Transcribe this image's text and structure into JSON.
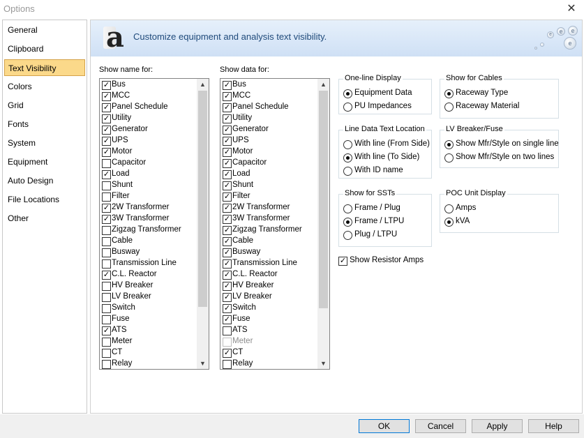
{
  "window": {
    "title": "Options",
    "close_label": "✕"
  },
  "sidebar": {
    "items": [
      {
        "label": "General"
      },
      {
        "label": "Clipboard"
      },
      {
        "label": "Text Visibility",
        "active": true
      },
      {
        "label": "Colors"
      },
      {
        "label": "Grid"
      },
      {
        "label": "Fonts"
      },
      {
        "label": "System"
      },
      {
        "label": "Equipment"
      },
      {
        "label": "Auto Design"
      },
      {
        "label": "File Locations"
      },
      {
        "label": "Other"
      }
    ]
  },
  "header": {
    "logo_text": "a",
    "subtitle": "Customize equipment and analysis text visibility."
  },
  "show_name": {
    "label": "Show name for:",
    "items": [
      {
        "label": "Bus",
        "checked": true
      },
      {
        "label": "MCC",
        "checked": true
      },
      {
        "label": "Panel Schedule",
        "checked": true
      },
      {
        "label": "Utility",
        "checked": true
      },
      {
        "label": "Generator",
        "checked": true
      },
      {
        "label": "UPS",
        "checked": true
      },
      {
        "label": "Motor",
        "checked": true
      },
      {
        "label": "Capacitor",
        "checked": false
      },
      {
        "label": "Load",
        "checked": true
      },
      {
        "label": "Shunt",
        "checked": false
      },
      {
        "label": "Filter",
        "checked": false
      },
      {
        "label": "2W Transformer",
        "checked": true
      },
      {
        "label": "3W Transformer",
        "checked": true
      },
      {
        "label": "Zigzag Transformer",
        "checked": false
      },
      {
        "label": "Cable",
        "checked": false
      },
      {
        "label": "Busway",
        "checked": false
      },
      {
        "label": "Transmission Line",
        "checked": false
      },
      {
        "label": "C.L. Reactor",
        "checked": true
      },
      {
        "label": "HV Breaker",
        "checked": false
      },
      {
        "label": "LV Breaker",
        "checked": false
      },
      {
        "label": "Switch",
        "checked": false
      },
      {
        "label": "Fuse",
        "checked": false
      },
      {
        "label": "ATS",
        "checked": true
      },
      {
        "label": "Meter",
        "checked": false
      },
      {
        "label": "CT",
        "checked": false
      },
      {
        "label": "Relay",
        "checked": false
      }
    ]
  },
  "show_data": {
    "label": "Show data for:",
    "items": [
      {
        "label": "Bus",
        "checked": true
      },
      {
        "label": "MCC",
        "checked": true
      },
      {
        "label": "Panel Schedule",
        "checked": true
      },
      {
        "label": "Utility",
        "checked": true
      },
      {
        "label": "Generator",
        "checked": true
      },
      {
        "label": "UPS",
        "checked": true
      },
      {
        "label": "Motor",
        "checked": true
      },
      {
        "label": "Capacitor",
        "checked": true
      },
      {
        "label": "Load",
        "checked": true
      },
      {
        "label": "Shunt",
        "checked": true
      },
      {
        "label": "Filter",
        "checked": true
      },
      {
        "label": "2W Transformer",
        "checked": true
      },
      {
        "label": "3W Transformer",
        "checked": true
      },
      {
        "label": "Zigzag Transformer",
        "checked": true
      },
      {
        "label": "Cable",
        "checked": true
      },
      {
        "label": "Busway",
        "checked": true
      },
      {
        "label": "Transmission Line",
        "checked": true
      },
      {
        "label": "C.L. Reactor",
        "checked": true
      },
      {
        "label": "HV Breaker",
        "checked": true
      },
      {
        "label": "LV Breaker",
        "checked": true
      },
      {
        "label": "Switch",
        "checked": true
      },
      {
        "label": "Fuse",
        "checked": true
      },
      {
        "label": "ATS",
        "checked": false
      },
      {
        "label": "Meter",
        "checked": false,
        "disabled": true
      },
      {
        "label": "CT",
        "checked": true
      },
      {
        "label": "Relay",
        "checked": false
      }
    ]
  },
  "groups": {
    "one_line_display": {
      "title": "One-line Display",
      "options": [
        {
          "label": "Equipment Data",
          "selected": true
        },
        {
          "label": "PU Impedances",
          "selected": false
        }
      ]
    },
    "show_for_cables": {
      "title": "Show for Cables",
      "options": [
        {
          "label": "Raceway Type",
          "selected": true
        },
        {
          "label": "Raceway Material",
          "selected": false
        }
      ]
    },
    "line_data_text_location": {
      "title": "Line Data Text Location",
      "options": [
        {
          "label": "With line (From Side)",
          "selected": false
        },
        {
          "label": "With line (To Side)",
          "selected": true
        },
        {
          "label": "With ID name",
          "selected": false
        }
      ]
    },
    "lv_breaker_fuse": {
      "title": "LV Breaker/Fuse",
      "options": [
        {
          "label": "Show Mfr/Style on single line",
          "selected": true
        },
        {
          "label": "Show Mfr/Style on two lines",
          "selected": false
        }
      ]
    },
    "show_for_ssts": {
      "title": "Show for SSTs",
      "options": [
        {
          "label": "Frame / Plug",
          "selected": false
        },
        {
          "label": "Frame / LTPU",
          "selected": true
        },
        {
          "label": "Plug / LTPU",
          "selected": false
        }
      ]
    },
    "poc_unit_display": {
      "title": "POC Unit Display",
      "options": [
        {
          "label": "Amps",
          "selected": false
        },
        {
          "label": "kVA",
          "selected": true
        }
      ]
    }
  },
  "show_resistor_amps": {
    "label": "Show Resistor Amps",
    "checked": true
  },
  "buttons": {
    "ok": "OK",
    "cancel": "Cancel",
    "apply": "Apply",
    "help": "Help"
  }
}
